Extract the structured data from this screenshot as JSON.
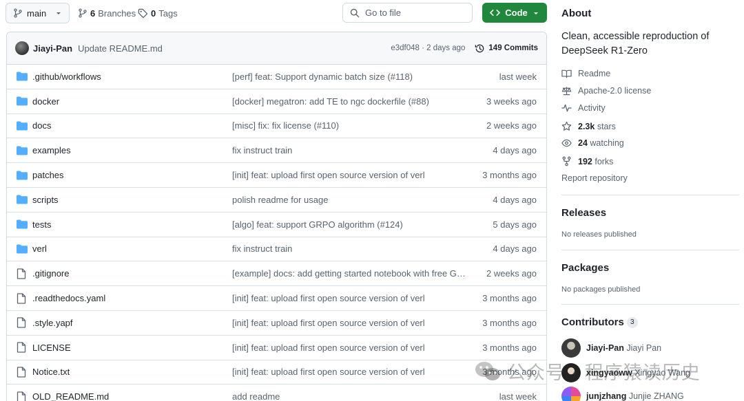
{
  "toolbar": {
    "branch": "main",
    "branches_count": "6",
    "branches_label": "Branches",
    "tags_count": "0",
    "tags_label": "Tags",
    "goto_placeholder": "Go to file",
    "code_label": "Code"
  },
  "commit": {
    "author": "Jiayi-Pan",
    "message": "Update README.md",
    "sha_age": "e3df048 · 2 days ago",
    "commits_label": "149 Commits"
  },
  "files": [
    {
      "type": "folder",
      "name": ".github/workflows",
      "message": "[perf] feat: Support dynamic batch size (#118)",
      "date": "last week"
    },
    {
      "type": "folder",
      "name": "docker",
      "message": "[docker] megatron: add TE to ngc dockerfile (#88)",
      "date": "3 weeks ago"
    },
    {
      "type": "folder",
      "name": "docs",
      "message": "[misc] fix: fix license (#110)",
      "date": "2 weeks ago"
    },
    {
      "type": "folder",
      "name": "examples",
      "message": "fix instruct train",
      "date": "4 days ago"
    },
    {
      "type": "folder",
      "name": "patches",
      "message": "[init] feat: upload first open source version of verl",
      "date": "3 months ago"
    },
    {
      "type": "folder",
      "name": "scripts",
      "message": "polish readme for usage",
      "date": "4 days ago"
    },
    {
      "type": "folder",
      "name": "tests",
      "message": "[algo] feat: support GRPO algorithm (#124)",
      "date": "5 days ago"
    },
    {
      "type": "folder",
      "name": "verl",
      "message": "fix instruct train",
      "date": "4 days ago"
    },
    {
      "type": "file",
      "name": ".gitignore",
      "message": "[example] docs: add getting started notebook with free GPU...",
      "date": "2 weeks ago"
    },
    {
      "type": "file",
      "name": ".readthedocs.yaml",
      "message": "[init] feat: upload first open source version of verl",
      "date": "3 months ago"
    },
    {
      "type": "file",
      "name": ".style.yapf",
      "message": "[init] feat: upload first open source version of verl",
      "date": "3 months ago"
    },
    {
      "type": "file",
      "name": "LICENSE",
      "message": "[init] feat: upload first open source version of verl",
      "date": "3 months ago"
    },
    {
      "type": "file",
      "name": "Notice.txt",
      "message": "[init] feat: upload first open source version of verl",
      "date": "3 months ago"
    },
    {
      "type": "file",
      "name": "OLD_README.md",
      "message": "add readme",
      "date": "last week"
    }
  ],
  "about": {
    "heading": "About",
    "description": "Clean, accessible reproduction of DeepSeek R1-Zero",
    "readme": "Readme",
    "license": "Apache-2.0 license",
    "activity": "Activity",
    "stars_count": "2.3k",
    "stars_label": "stars",
    "watching_count": "24",
    "watching_label": "watching",
    "forks_count": "192",
    "forks_label": "forks",
    "report": "Report repository"
  },
  "releases": {
    "heading": "Releases",
    "empty": "No releases published"
  },
  "packages": {
    "heading": "Packages",
    "empty": "No packages published"
  },
  "contributors": {
    "heading": "Contributors",
    "count": "3",
    "list": [
      {
        "login": "Jiayi-Pan",
        "name": "Jiayi Pan"
      },
      {
        "login": "xingyaoww",
        "name": "Xingyao Wang"
      },
      {
        "login": "junjzhang",
        "name": "Junjie ZHANG"
      }
    ]
  },
  "watermark": {
    "text": "公众号 · 程序猿读历史"
  },
  "colors": {
    "accent_green": "#1f883d",
    "folder_blue": "#54aeff",
    "muted": "#59636e"
  }
}
